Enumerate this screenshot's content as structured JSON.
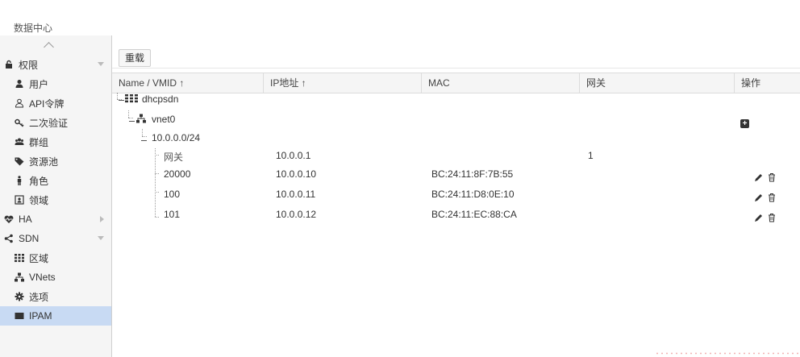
{
  "header": {
    "title": "数据中心"
  },
  "sidebar": {
    "items": [
      {
        "label": "权限",
        "icon": "lock-icon",
        "level": 0,
        "expander": "down"
      },
      {
        "label": "用户",
        "icon": "user-icon",
        "level": 1
      },
      {
        "label": "API令牌",
        "icon": "user-outline-icon",
        "level": 1
      },
      {
        "label": "二次验证",
        "icon": "key-icon",
        "level": 1
      },
      {
        "label": "群组",
        "icon": "group-icon",
        "level": 1
      },
      {
        "label": "资源池",
        "icon": "tag-icon",
        "level": 1
      },
      {
        "label": "角色",
        "icon": "person-icon",
        "level": 1
      },
      {
        "label": "领域",
        "icon": "id-card-icon",
        "level": 1
      },
      {
        "label": "HA",
        "icon": "heartbeat-icon",
        "level": 0,
        "expander": "right"
      },
      {
        "label": "SDN",
        "icon": "sdn-icon",
        "level": 0,
        "expander": "down"
      },
      {
        "label": "区域",
        "icon": "grid-icon",
        "level": 1
      },
      {
        "label": "VNets",
        "icon": "network-icon",
        "level": 1
      },
      {
        "label": "选项",
        "icon": "gear-icon",
        "level": 1
      },
      {
        "label": "IPAM",
        "icon": "ipam-icon",
        "level": 1,
        "selected": true
      }
    ]
  },
  "toolbar": {
    "reload_label": "重载"
  },
  "table": {
    "columns": [
      "Name / VMID ↑",
      "IP地址 ↑",
      "MAC",
      "网关",
      "操作"
    ],
    "rows": [
      {
        "name": "dhcpsdn",
        "ip": "",
        "mac": "",
        "gateway": "",
        "type": "zone",
        "actions": []
      },
      {
        "name": "vnet0",
        "ip": "",
        "mac": "",
        "gateway": "",
        "type": "vnet",
        "actions": [
          "add"
        ]
      },
      {
        "name": "10.0.0.0/24",
        "ip": "",
        "mac": "",
        "gateway": "",
        "type": "subnet",
        "actions": []
      },
      {
        "name": "网关",
        "ip": "10.0.0.1",
        "mac": "",
        "gateway": "1",
        "type": "gateway",
        "actions": []
      },
      {
        "name": "20000",
        "ip": "10.0.0.10",
        "mac": "BC:24:11:8F:7B:55",
        "gateway": "",
        "type": "vm",
        "actions": [
          "edit",
          "delete"
        ]
      },
      {
        "name": "100",
        "ip": "10.0.0.11",
        "mac": "BC:24:11:D8:0E:10",
        "gateway": "",
        "type": "vm",
        "actions": [
          "edit",
          "delete"
        ]
      },
      {
        "name": "101",
        "ip": "10.0.0.12",
        "mac": "BC:24:11:EC:88:CA",
        "gateway": "",
        "type": "vm",
        "actions": [
          "edit",
          "delete"
        ]
      }
    ]
  },
  "colors": {
    "selected_bg": "#c8daf3",
    "sidebar_bg": "#f5f5f5",
    "header_border": "#d9d9d9"
  }
}
